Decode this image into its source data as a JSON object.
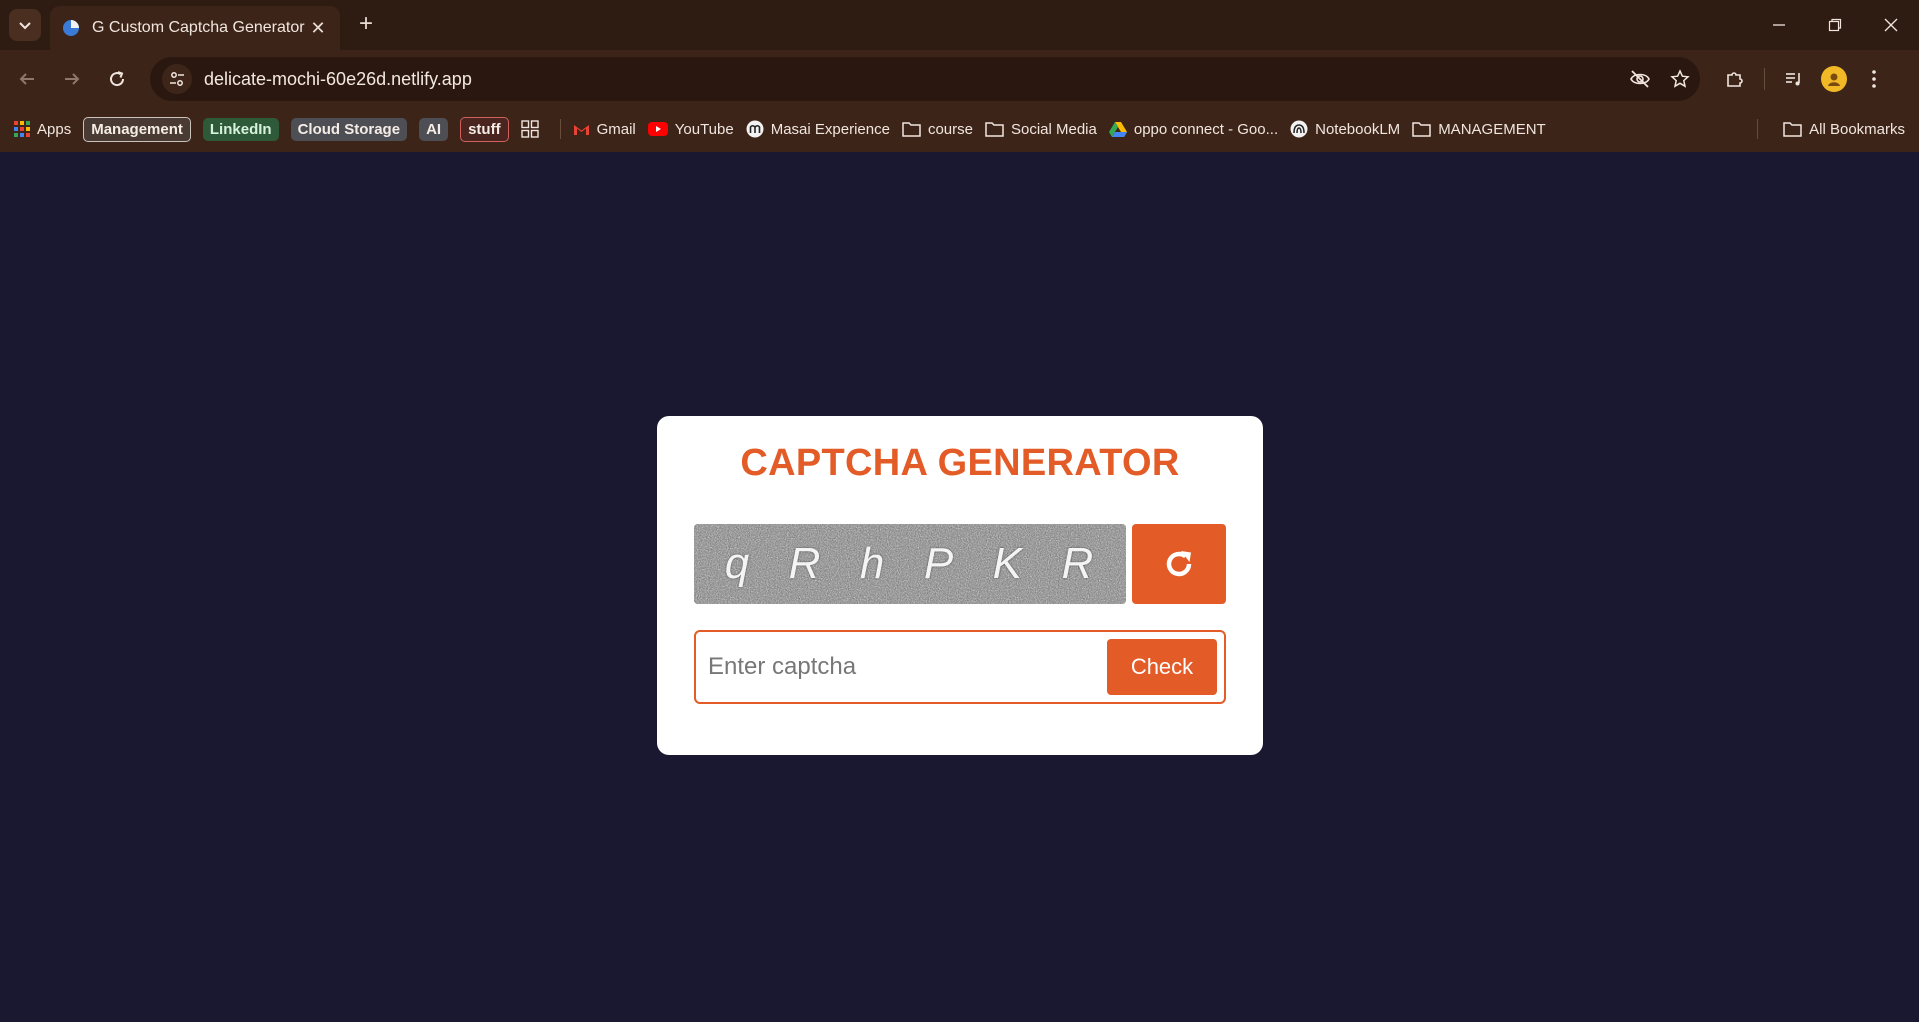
{
  "browser": {
    "tab_title": "G Custom Captcha Generator",
    "url": "delicate-mochi-60e26d.netlify.app",
    "bookmarks": {
      "apps": "Apps",
      "management": "Management",
      "linkedin": "LinkedIn",
      "cloud_storage": "Cloud Storage",
      "ai": "AI",
      "stuff": "stuff",
      "gmail": "Gmail",
      "youtube": "YouTube",
      "masai": "Masai Experience",
      "course": "course",
      "social_media": "Social Media",
      "oppo": "oppo connect - Goo...",
      "notebooklm": "NotebookLM",
      "management_folder": "MANAGEMENT",
      "all_bookmarks": "All Bookmarks"
    }
  },
  "page": {
    "title": "CAPTCHA GENERATOR",
    "captcha_chars": [
      "q",
      "R",
      "h",
      "P",
      "K",
      "R"
    ],
    "input_placeholder": "Enter captcha",
    "input_value": "",
    "check_label": "Check"
  },
  "colors": {
    "accent": "#e35b26",
    "page_bg": "#1a1830",
    "card_bg": "#ffffff",
    "chrome_bg": "#3c2418"
  }
}
